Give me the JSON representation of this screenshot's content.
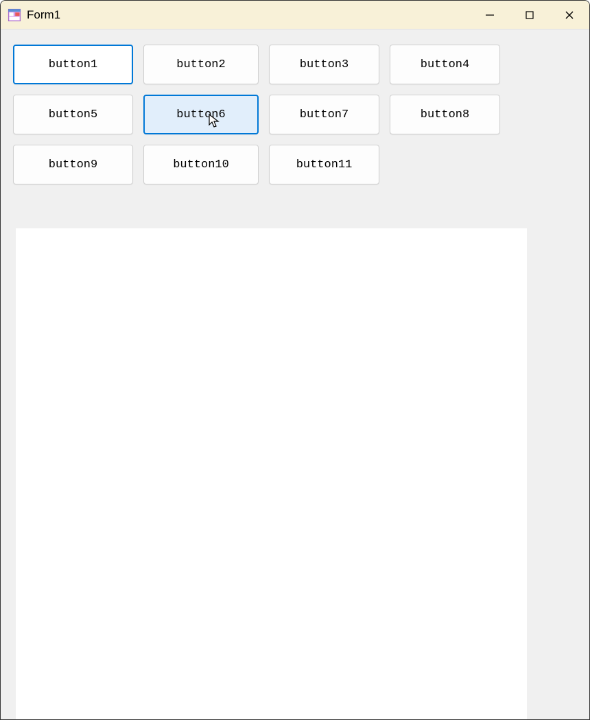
{
  "window": {
    "title": "Form1"
  },
  "buttons": [
    {
      "label": "button1",
      "state": "focused"
    },
    {
      "label": "button2",
      "state": "normal"
    },
    {
      "label": "button3",
      "state": "normal"
    },
    {
      "label": "button4",
      "state": "normal"
    },
    {
      "label": "button5",
      "state": "normal"
    },
    {
      "label": "button6",
      "state": "hovered"
    },
    {
      "label": "button7",
      "state": "normal"
    },
    {
      "label": "button8",
      "state": "normal"
    },
    {
      "label": "button9",
      "state": "normal"
    },
    {
      "label": "button10",
      "state": "normal"
    },
    {
      "label": "button11",
      "state": "normal"
    }
  ]
}
